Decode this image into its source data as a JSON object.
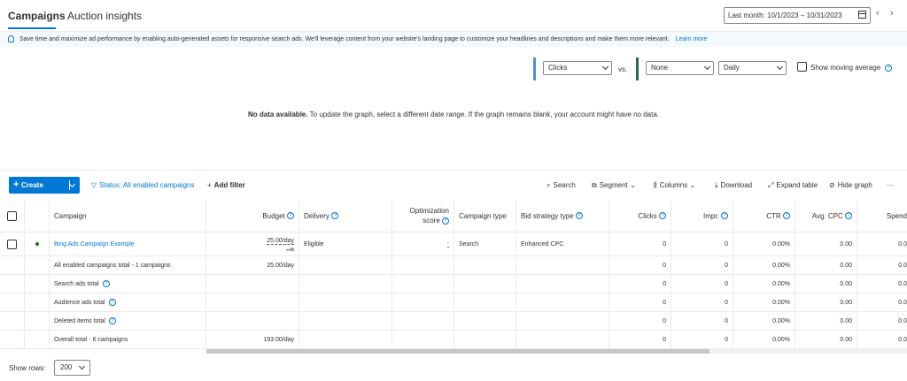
{
  "tabs": {
    "campaigns": "Campaigns",
    "auction": "Auction insights"
  },
  "date_range": "Last month: 10/1/2023 – 10/31/2023",
  "nav": {
    "prev": "‹",
    "next": "›"
  },
  "banner": {
    "text": "Save time and maximize ad performance by enabling auto-generated assets for responsive search ads. We'll leverage content from your website's landing page to customize your headlines and descriptions and make them more relevant.",
    "link": "Learn more"
  },
  "graph": {
    "metric1": "Clicks",
    "vs": "vs.",
    "metric2": "None",
    "interval": "Daily",
    "moving_average": "Show moving average",
    "no_data_bold": "No data available.",
    "no_data_rest": " To update the graph, select a different date range. If the graph remains blank, your account might have no data.",
    "colors": {
      "series1": "#4e8ed4",
      "series2": "#2d6a4f"
    }
  },
  "toolbar": {
    "create": "Create",
    "status": "Status: All enabled campaigns",
    "add_filter": "Add filter",
    "search": "Search",
    "segment": "Segment",
    "columns": "Columns",
    "download": "Download",
    "expand": "Expand table",
    "hide_graph": "Hide graph",
    "more": "···"
  },
  "table": {
    "headers": {
      "campaign": "Campaign",
      "budget": "Budget",
      "delivery": "Delivery",
      "opt1": "Optimization",
      "opt2": "score",
      "type": "Campaign type",
      "bid": "Bid strategy type",
      "clicks": "Clicks",
      "impr": "Impr.",
      "ctr": "CTR",
      "cpc": "Avg. CPC",
      "spend": "Spend"
    },
    "campaign_row": {
      "name": "Bing Ads Campaign Example",
      "budget": "25.00/day",
      "delivery": "Eligible",
      "opt": "-",
      "type": "Search",
      "bid": "Enhanced CPC",
      "clicks": "0",
      "impr": "0",
      "ctr": "0.00%",
      "cpc": "0.00",
      "spend": "0.0"
    },
    "totals": [
      {
        "label": "All enabled campaigns total - 1 campaigns",
        "budget": "25.00/day",
        "clicks": "0",
        "impr": "0",
        "ctr": "0.00%",
        "cpc": "0.00",
        "spend": "0.0",
        "help": false
      },
      {
        "label": "Search ads total",
        "budget": "",
        "clicks": "0",
        "impr": "0",
        "ctr": "0.00%",
        "cpc": "0.00",
        "spend": "0.0",
        "help": true
      },
      {
        "label": "Audience ads total",
        "budget": "",
        "clicks": "0",
        "impr": "0",
        "ctr": "0.00%",
        "cpc": "0.00",
        "spend": "0.0",
        "help": true
      },
      {
        "label": "Deleted items total",
        "budget": "",
        "clicks": "0",
        "impr": "0",
        "ctr": "0.00%",
        "cpc": "0.00",
        "spend": "0.0",
        "help": true
      },
      {
        "label": "Overall total - 6 campaigns",
        "budget": "193.00/day",
        "clicks": "0",
        "impr": "0",
        "ctr": "0.00%",
        "cpc": "0.00",
        "spend": "0.0",
        "help": false
      }
    ]
  },
  "footer": {
    "show_rows": "Show rows:",
    "rows_value": "200"
  },
  "help_glyph": "?"
}
